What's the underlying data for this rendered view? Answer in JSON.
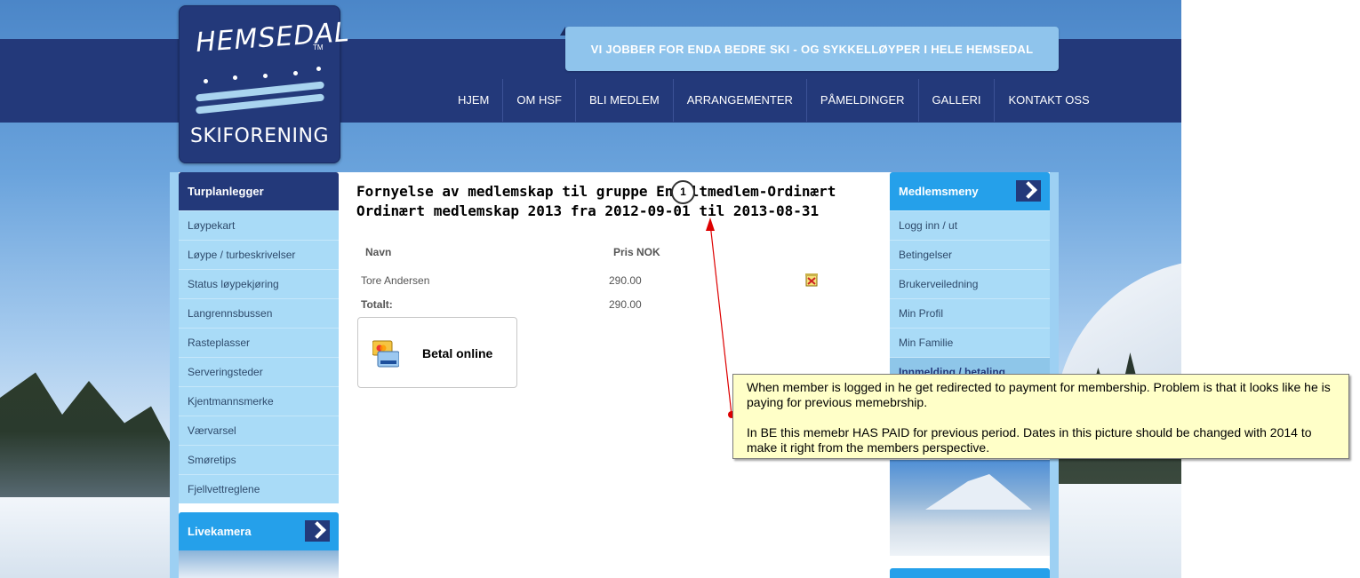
{
  "logo": {
    "wordmark": "HEMSEDAL",
    "tm": "TM",
    "subtitle": "SKIFORENING"
  },
  "slogan": "VI JOBBER FOR ENDA BEDRE SKI - OG SYKKELLØYPER I HELE HEMSEDAL",
  "topnav": [
    "HJEM",
    "OM HSF",
    "BLI MEDLEM",
    "ARRANGEMENTER",
    "PÅMELDINGER",
    "GALLERI",
    "KONTAKT OSS"
  ],
  "left_menu": {
    "title": "Turplanlegger",
    "items": [
      "Løypekart",
      "Løype / turbeskrivelser",
      "Status løypekjøring",
      "Langrennsbussen",
      "Rasteplasser",
      "Serveringsteder",
      "Kjentmannsmerke",
      "Værvarsel",
      "Smøretips",
      "Fjellvettreglene"
    ]
  },
  "livecam": {
    "title": "Livekamera"
  },
  "right_menu": {
    "title": "Medlemsmeny",
    "items": [
      "Logg inn / ut",
      "Betingelser",
      "Brukerveiledning",
      "Min Profil",
      "Min Familie",
      "Innmelding / betaling"
    ]
  },
  "main": {
    "title_line1": "Fornyelse av medlemskap til gruppe Enkeltmedlem-Ordinært",
    "title_line2": "Ordinært medlemskap 2013 fra 2012-09-01 til 2013-08-31",
    "col_name": "Navn",
    "col_price": "Pris NOK",
    "row_name": "Tore Andersen",
    "row_price": "290.00",
    "total_label": "Totalt:",
    "total_price": "290.00",
    "pay_label": "Betal online"
  },
  "annotation": {
    "marker": "1",
    "para1": "When member is logged in he get redirected to payment for membership. Problem is that it looks like he is paying for previous memebrship.",
    "para2": "In BE this memebr HAS PAID for previous period. Dates in this picture should be changed with 2014 to make it right from the members perspective."
  }
}
